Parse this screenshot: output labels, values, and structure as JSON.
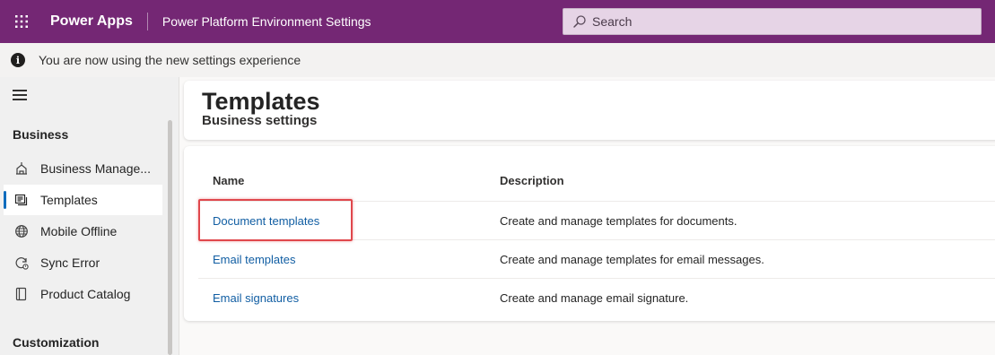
{
  "topbar": {
    "app_name": "Power Apps",
    "environment_title": "Power Platform Environment Settings",
    "search_placeholder": "Search",
    "waffle_icon": "waffle-icon",
    "colors": {
      "background": "#742774"
    }
  },
  "infobar": {
    "message": "You are now using the new settings experience",
    "icon": "info-icon"
  },
  "sidebar": {
    "sections": [
      {
        "label": "Business",
        "items": [
          {
            "label": "Business Manage...",
            "icon": "business-management-icon"
          },
          {
            "label": "Templates",
            "icon": "templates-icon",
            "selected": true
          },
          {
            "label": "Mobile Offline",
            "icon": "globe-icon"
          },
          {
            "label": "Sync Error",
            "icon": "sync-error-icon"
          },
          {
            "label": "Product Catalog",
            "icon": "product-catalog-icon"
          }
        ]
      },
      {
        "label": "Customization",
        "items": []
      }
    ]
  },
  "page": {
    "title": "Templates",
    "subtitle": "Business settings"
  },
  "table": {
    "columns": [
      "Name",
      "Description"
    ],
    "rows": [
      {
        "name": "Document templates",
        "description": "Create and manage templates for documents.",
        "highlighted": true
      },
      {
        "name": "Email templates",
        "description": "Create and manage templates for email messages."
      },
      {
        "name": "Email signatures",
        "description": "Create and manage email signature."
      }
    ]
  },
  "colors": {
    "accent": "#0f6cbd",
    "link": "#115ea3",
    "highlight_border": "#e0474c"
  }
}
